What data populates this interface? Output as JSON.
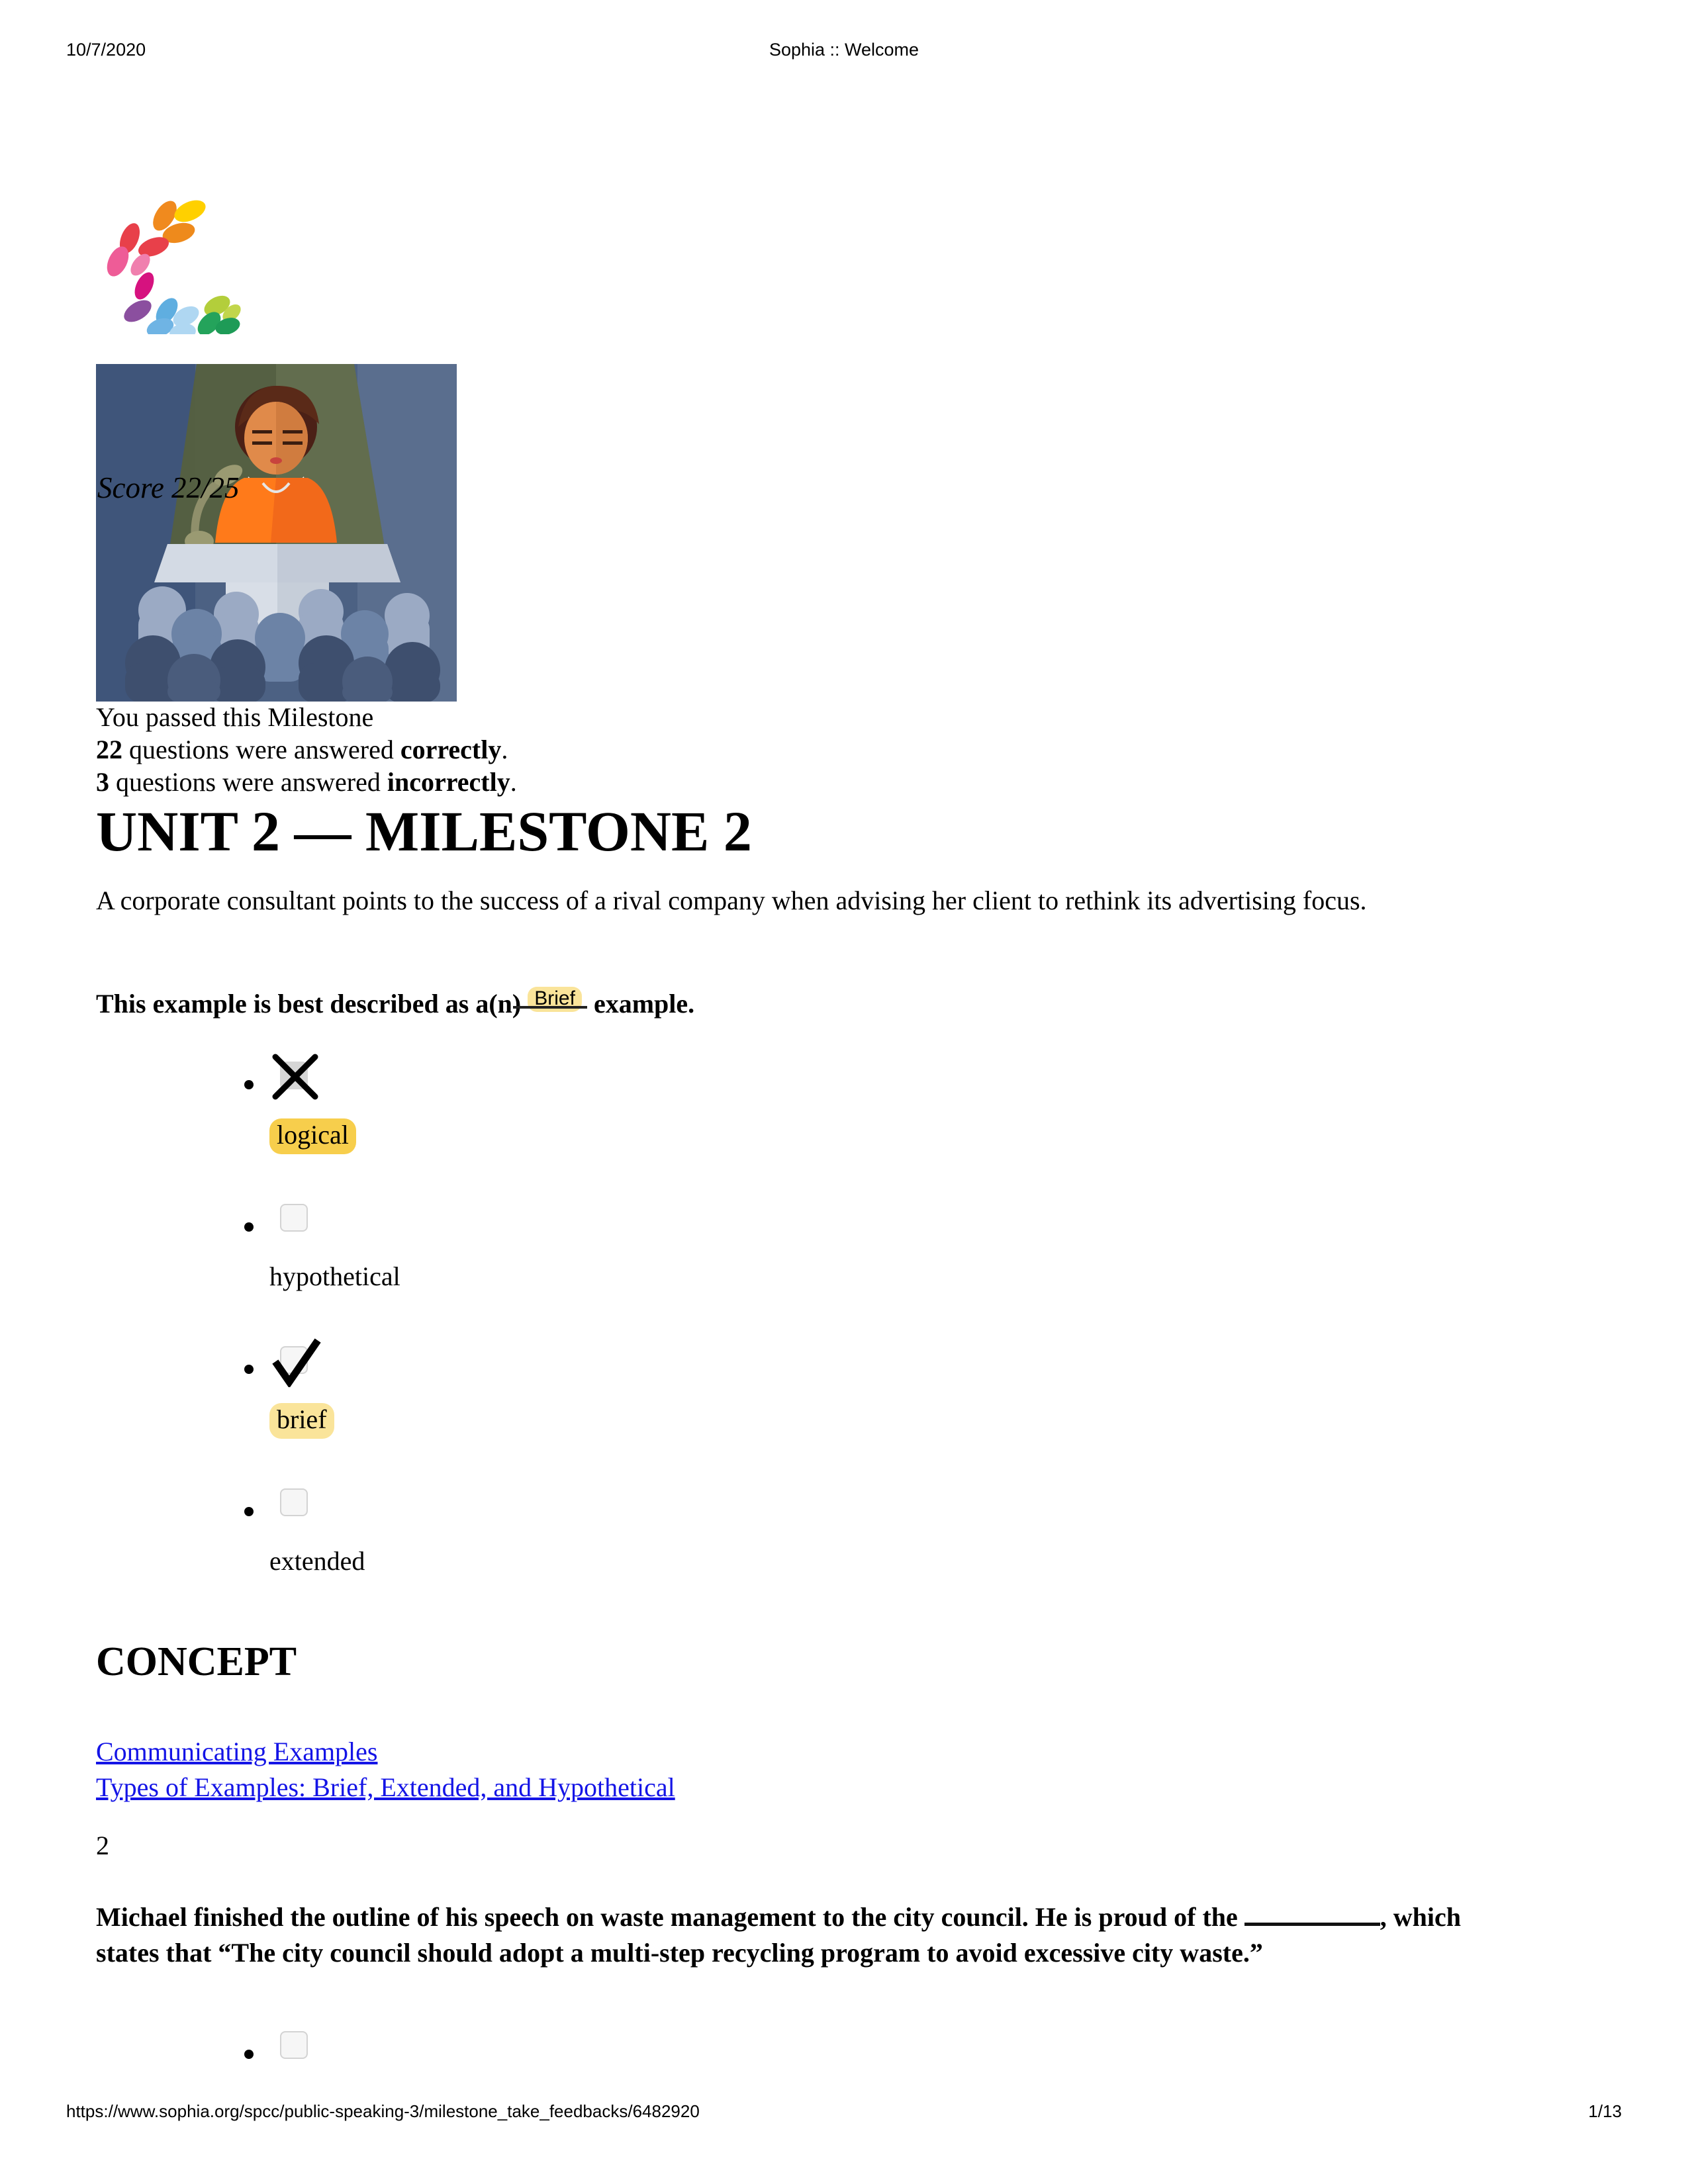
{
  "print": {
    "date": "10/7/2020",
    "doc_title": "Sophia :: Welcome",
    "url": "https://www.sophia.org/spcc/public-speaking-3/milestone_take_feedbacks/6482920",
    "page": "1/13"
  },
  "logo": {
    "name": "sophia-logo",
    "colors": [
      "#F5A623",
      "#FFD400",
      "#E8433F",
      "#EE5B92",
      "#D6177E",
      "#8B4F9F",
      "#5AA9DD",
      "#A9D5F0",
      "#2AA35D",
      "#B9D435"
    ]
  },
  "hero": {
    "alt": "speaker at podium addressing an audience",
    "score_label": "Score 22/25"
  },
  "result": {
    "line1": "You passed this Milestone",
    "correct_count": "22",
    "line2_mid": " questions were answered ",
    "correct_word": "correctly",
    "line2_end": ".",
    "incorrect_count": "3",
    "line3_mid": " questions were answered ",
    "incorrect_word": "incorrectly",
    "line3_end": "."
  },
  "page_title": "UNIT 2 — MILESTONE 2",
  "questions": [
    {
      "stem": "A corporate consultant points to the success of a rival company when advising her client to rethink its advertising focus.",
      "prompt_before": "This example is best described as a(n)",
      "answer_annotation": "Brief",
      "prompt_after": "example.",
      "options": [
        {
          "label": "logical",
          "state": "incorrect-selected",
          "highlight": "gold"
        },
        {
          "label": "hypothetical",
          "state": "unselected",
          "highlight": "none"
        },
        {
          "label": "brief",
          "state": "correct",
          "highlight": "pale"
        },
        {
          "label": "extended",
          "state": "unselected",
          "highlight": "none"
        }
      ],
      "concept_heading": "CONCEPT",
      "concept_links": [
        "Communicating Examples",
        "Types of Examples: Brief, Extended, and Hypothetical"
      ]
    },
    {
      "number": "2",
      "prompt_line1": "Michael finished the outline of his speech on waste management to the city council. He is proud of the",
      "prompt_line2_after_blank": ", which states that “The city council should adopt a multi-step recycling program to avoid",
      "prompt_line3": "excessive city waste.”",
      "options": [
        {
          "label": "",
          "state": "unselected",
          "highlight": "none"
        }
      ]
    }
  ]
}
